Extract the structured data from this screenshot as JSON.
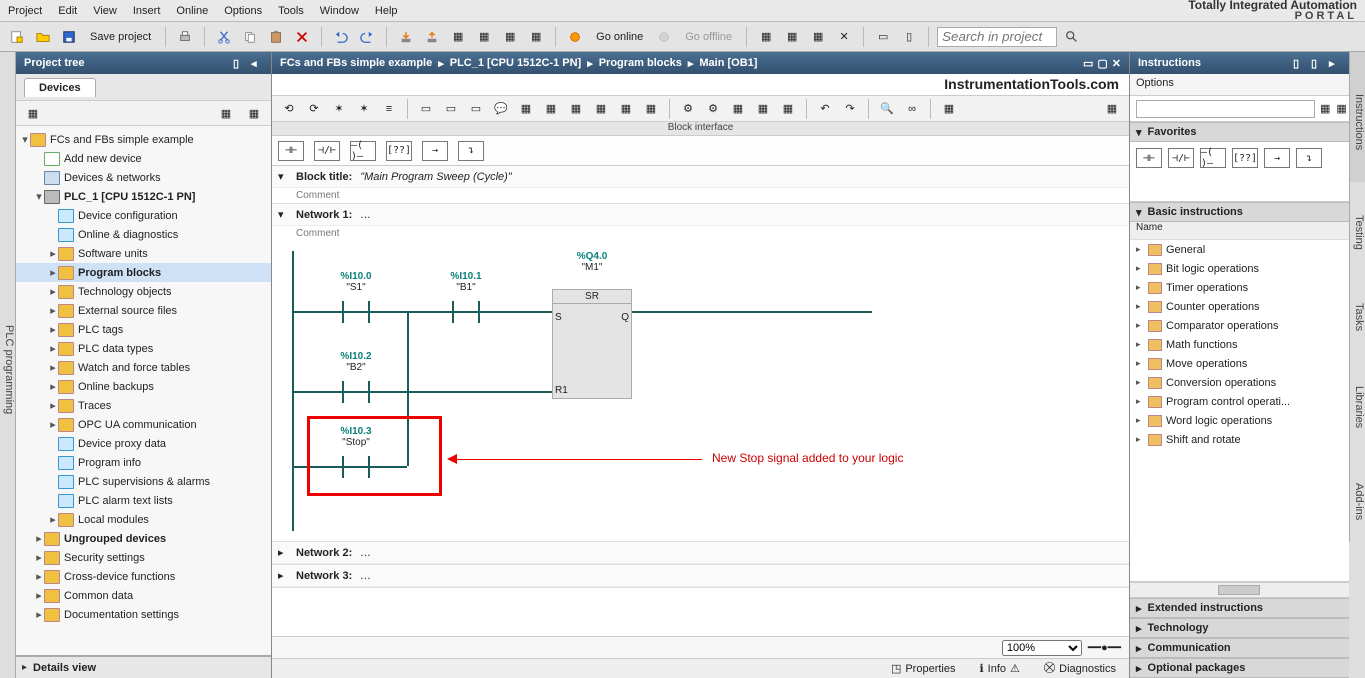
{
  "brand": {
    "line1": "Totally Integrated Automation",
    "line2": "PORTAL"
  },
  "menu": [
    "Project",
    "Edit",
    "View",
    "Insert",
    "Online",
    "Options",
    "Tools",
    "Window",
    "Help"
  ],
  "toolbar": {
    "save": "Save project",
    "go_online": "Go online",
    "go_offline": "Go offline",
    "search_ph": "Search in project"
  },
  "side_left": "PLC programming",
  "side_right": [
    "Instructions",
    "Testing",
    "Tasks",
    "Libraries",
    "Add-ins"
  ],
  "project_tree": {
    "title": "Project tree",
    "tab": "Devices",
    "details": "Details view",
    "items": [
      {
        "ind": 0,
        "arr": "▾",
        "ico": "fld",
        "txt": "FCs and FBs simple example"
      },
      {
        "ind": 1,
        "arr": "",
        "ico": "add",
        "txt": "Add new device"
      },
      {
        "ind": 1,
        "arr": "",
        "ico": "net",
        "txt": "Devices & networks"
      },
      {
        "ind": 1,
        "arr": "▾",
        "ico": "plc",
        "txt": "PLC_1 [CPU 1512C-1 PN]",
        "bold": true
      },
      {
        "ind": 2,
        "arr": "",
        "ico": "cfg",
        "txt": "Device configuration"
      },
      {
        "ind": 2,
        "arr": "",
        "ico": "cfg",
        "txt": "Online & diagnostics"
      },
      {
        "ind": 2,
        "arr": "▸",
        "ico": "fld",
        "txt": "Software units"
      },
      {
        "ind": 2,
        "arr": "▸",
        "ico": "fld",
        "txt": "Program blocks",
        "bold": true,
        "sel": true
      },
      {
        "ind": 2,
        "arr": "▸",
        "ico": "fld",
        "txt": "Technology objects"
      },
      {
        "ind": 2,
        "arr": "▸",
        "ico": "fld",
        "txt": "External source files"
      },
      {
        "ind": 2,
        "arr": "▸",
        "ico": "fld",
        "txt": "PLC tags"
      },
      {
        "ind": 2,
        "arr": "▸",
        "ico": "fld",
        "txt": "PLC data types"
      },
      {
        "ind": 2,
        "arr": "▸",
        "ico": "fld",
        "txt": "Watch and force tables"
      },
      {
        "ind": 2,
        "arr": "▸",
        "ico": "fld",
        "txt": "Online backups"
      },
      {
        "ind": 2,
        "arr": "▸",
        "ico": "fld",
        "txt": "Traces"
      },
      {
        "ind": 2,
        "arr": "▸",
        "ico": "fld",
        "txt": "OPC UA communication"
      },
      {
        "ind": 2,
        "arr": "",
        "ico": "cfg",
        "txt": "Device proxy data"
      },
      {
        "ind": 2,
        "arr": "",
        "ico": "cfg",
        "txt": "Program info"
      },
      {
        "ind": 2,
        "arr": "",
        "ico": "cfg",
        "txt": "PLC supervisions & alarms"
      },
      {
        "ind": 2,
        "arr": "",
        "ico": "cfg",
        "txt": "PLC alarm text lists"
      },
      {
        "ind": 2,
        "arr": "▸",
        "ico": "fld",
        "txt": "Local modules"
      },
      {
        "ind": 1,
        "arr": "▸",
        "ico": "fld",
        "txt": "Ungrouped devices",
        "bold": true
      },
      {
        "ind": 1,
        "arr": "▸",
        "ico": "fld",
        "txt": "Security settings"
      },
      {
        "ind": 1,
        "arr": "▸",
        "ico": "fld",
        "txt": "Cross-device functions"
      },
      {
        "ind": 1,
        "arr": "▸",
        "ico": "fld",
        "txt": "Common data"
      },
      {
        "ind": 1,
        "arr": "▸",
        "ico": "fld",
        "txt": "Documentation settings"
      }
    ]
  },
  "editor": {
    "crumbs": [
      "FCs and FBs simple example",
      "PLC_1 [CPU 1512C-1 PN]",
      "Program blocks",
      "Main [OB1]"
    ],
    "watermark": "InstrumentationTools.com",
    "block_iface": "Block interface",
    "block_title_lbl": "Block title:",
    "block_title_val": "\"Main Program Sweep (Cycle)\"",
    "comment": "Comment",
    "net1": "Network 1:",
    "net2": "Network 2:",
    "net3": "Network 3:",
    "annotation": "New Stop signal added to your logic",
    "tags": {
      "s1": {
        "adr": "%I10.0",
        "nm": "\"S1\""
      },
      "b1": {
        "adr": "%I10.1",
        "nm": "\"B1\""
      },
      "b2": {
        "adr": "%I10.2",
        "nm": "\"B2\""
      },
      "stop": {
        "adr": "%I10.3",
        "nm": "\"Stop\""
      },
      "q": {
        "adr": "%Q4.0",
        "nm": "\"M1\""
      }
    },
    "sr": {
      "name": "SR",
      "s": "S",
      "r": "R1",
      "q": "Q"
    },
    "zoom": "100%",
    "footer": {
      "props": "Properties",
      "info": "Info",
      "diag": "Diagnostics"
    }
  },
  "instr": {
    "title": "Instructions",
    "options": "Options",
    "fav": "Favorites",
    "basic": "Basic instructions",
    "name_col": "Name",
    "cats": [
      "General",
      "Bit logic operations",
      "Timer operations",
      "Counter operations",
      "Comparator operations",
      "Math functions",
      "Move operations",
      "Conversion operations",
      "Program control operati...",
      "Word logic operations",
      "Shift and rotate"
    ],
    "acc": [
      "Extended instructions",
      "Technology",
      "Communication",
      "Optional packages"
    ]
  },
  "lad_symbols": [
    "⊣ ⊢",
    "⊣/⊢",
    "⊣ ⊢",
    "[??]",
    "→",
    "↴"
  ]
}
